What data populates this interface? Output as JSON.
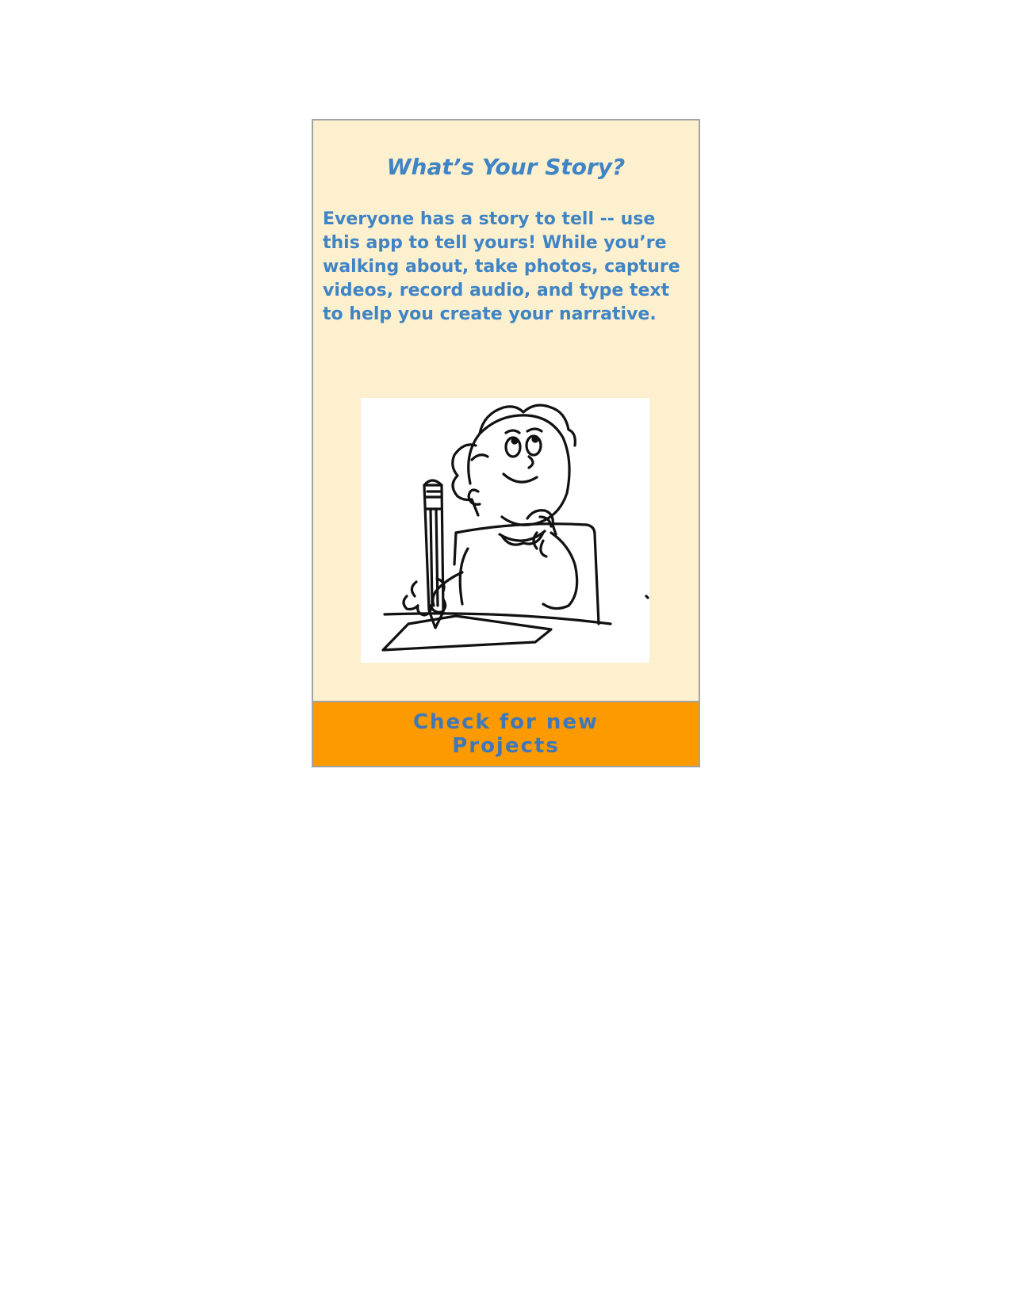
{
  "screen": {
    "title": "What’s Your Story?",
    "intro": "Everyone has a story to tell -- use this app to tell yours! While you’re walking about, take photos, capture videos, record audio, and type text to help you create your narrative.",
    "illustration_icon": "writer-thinking-illustration",
    "button_label": "Check for new Projects"
  },
  "colors": {
    "background": "#fdf0cf",
    "accent_text": "#3f84c4",
    "button": "#fc9a00",
    "button_text": "#3f78b8"
  }
}
